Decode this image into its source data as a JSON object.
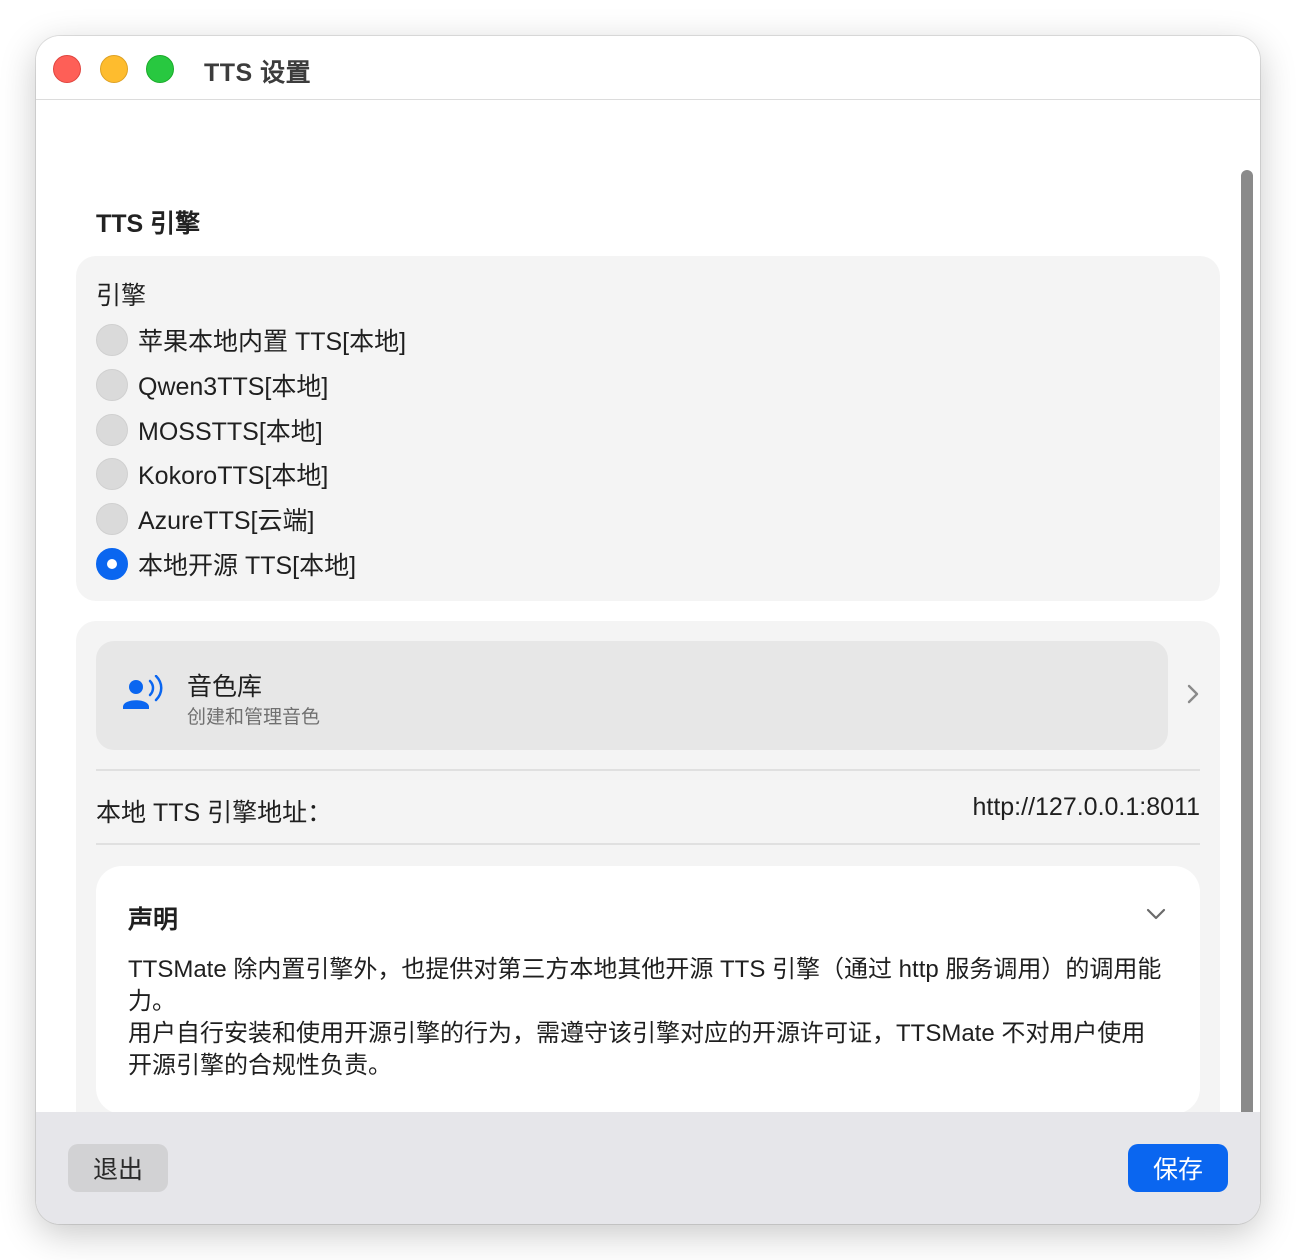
{
  "window": {
    "title": "TTS 设置"
  },
  "engine_section": {
    "title": "TTS 引擎",
    "label": "引擎",
    "options": [
      {
        "label": "苹果本地内置 TTS[本地]",
        "selected": false
      },
      {
        "label": "Qwen3TTS[本地]",
        "selected": false
      },
      {
        "label": "MOSSTTS[本地]",
        "selected": false
      },
      {
        "label": "KokoroTTS[本地]",
        "selected": false
      },
      {
        "label": "AzureTTS[云端]",
        "selected": false
      },
      {
        "label": "本地开源 TTS[本地]",
        "selected": true
      }
    ]
  },
  "voice_library": {
    "title": "音色库",
    "subtitle": "创建和管理音色",
    "icon": "person-speaking-icon"
  },
  "address": {
    "label": "本地 TTS 引擎地址：",
    "value": "http://127.0.0.1:8011"
  },
  "notice": {
    "title": "声明",
    "text": "TTSMate 除内置引擎外，也提供对第三方本地其他开源 TTS 引擎（通过 http 服务调用）的调用能力。\n用户自行安装和使用开源引擎的行为，需遵守该引擎对应的开源许可证，TTSMate 不对用户使用开源引擎的合规性负责。"
  },
  "footer": {
    "exit_label": "退出",
    "save_label": "保存"
  },
  "colors": {
    "accent": "#0a66f0",
    "close": "#fe5f57",
    "minimize": "#febc2e",
    "zoom": "#28c840"
  }
}
